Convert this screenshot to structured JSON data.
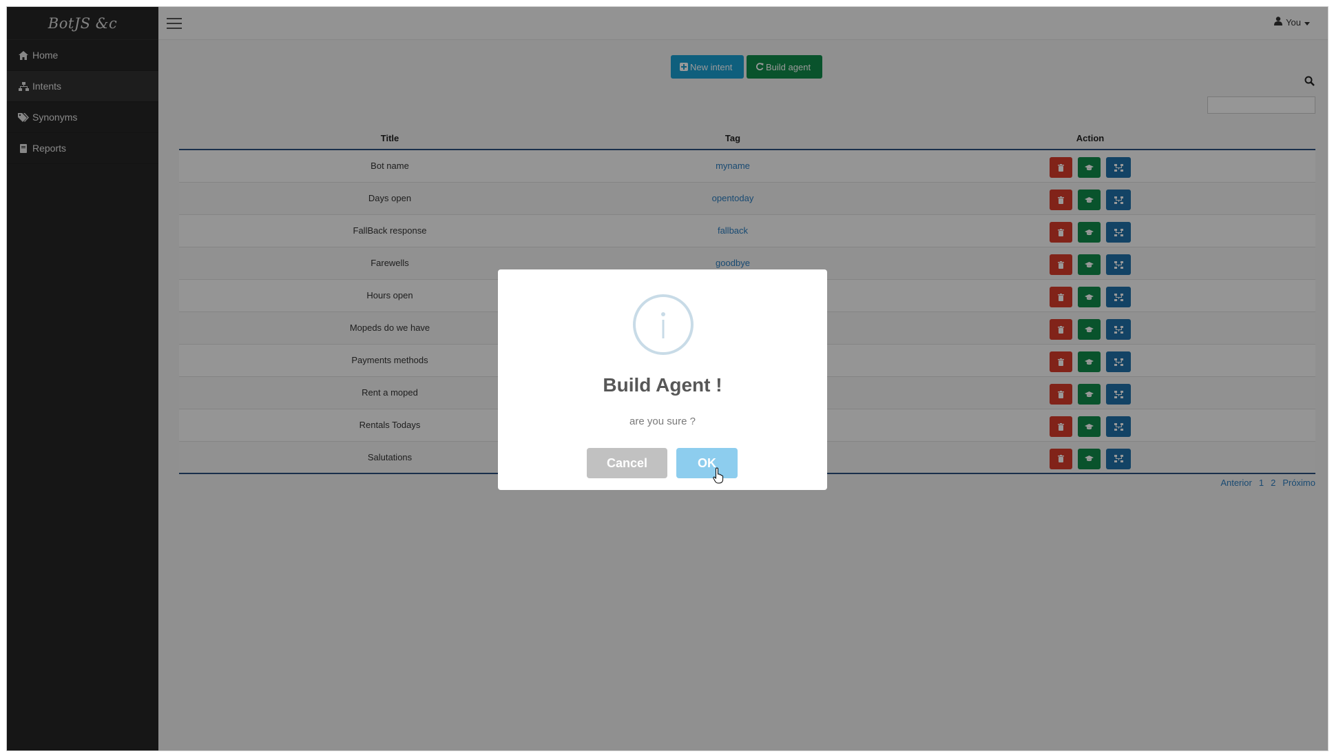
{
  "app": {
    "brand": "BotJS &c"
  },
  "sidebar": {
    "items": [
      {
        "label": "Home",
        "icon": "home-icon"
      },
      {
        "label": "Intents",
        "icon": "sitemap-icon",
        "active": true
      },
      {
        "label": "Synonyms",
        "icon": "tags-icon"
      },
      {
        "label": "Reports",
        "icon": "book-icon"
      }
    ]
  },
  "topbar": {
    "user_label": "You"
  },
  "toolbar": {
    "new_intent_label": "New intent",
    "build_agent_label": "Build agent"
  },
  "search": {
    "placeholder": ""
  },
  "table": {
    "headers": {
      "title": "Title",
      "tag": "Tag",
      "action": "Action"
    },
    "rows": [
      {
        "title": "Bot name",
        "tag": "myname"
      },
      {
        "title": "Days open",
        "tag": "opentoday"
      },
      {
        "title": "FallBack response",
        "tag": "fallback"
      },
      {
        "title": "Farewells",
        "tag": "goodbye"
      },
      {
        "title": "Hours open",
        "tag": ""
      },
      {
        "title": "Mopeds do we have",
        "tag": ""
      },
      {
        "title": "Payments methods",
        "tag": ""
      },
      {
        "title": "Rent a moped",
        "tag": ""
      },
      {
        "title": "Rentals Todays",
        "tag": ""
      },
      {
        "title": "Salutations",
        "tag": ""
      }
    ]
  },
  "pagination": {
    "prev": "Anterior",
    "page1": "1",
    "page2": "2",
    "next": "Próximo"
  },
  "modal": {
    "title": "Build Agent !",
    "text": "are you sure ?",
    "cancel_label": "Cancel",
    "ok_label": "OK",
    "icon": "info-icon"
  },
  "colors": {
    "sidebar_bg": "#262626",
    "info": "#1a9ed1",
    "success": "#0f8a4a",
    "danger": "#d83b2b",
    "primary": "#2071a8",
    "ok_button": "#8dcdee",
    "cancel_button": "#c1c1c1"
  }
}
